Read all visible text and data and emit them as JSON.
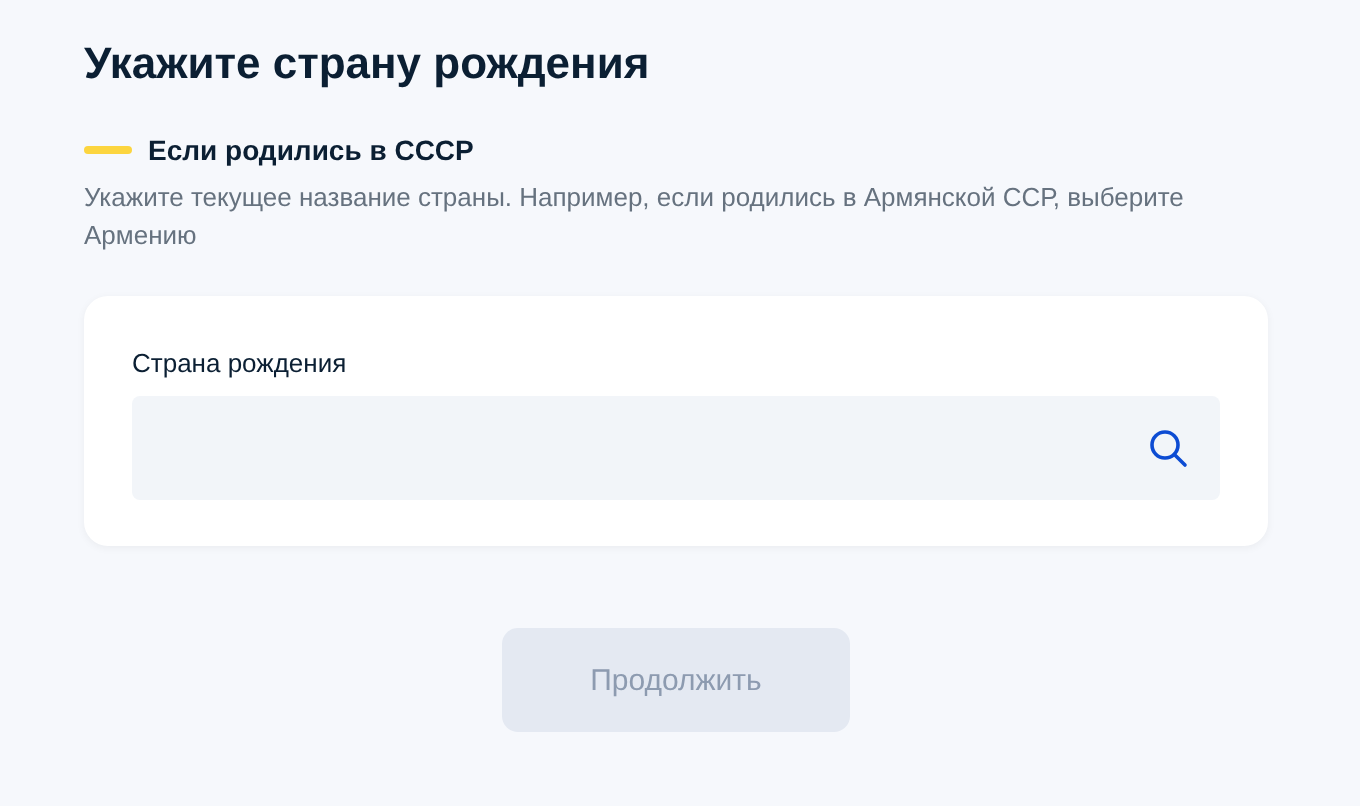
{
  "title": "Укажите страну рождения",
  "hint": {
    "title": "Если родились в СССР",
    "text": "Укажите текущее название страны. Например, если родились в Армянской ССР, выберите Армению"
  },
  "field": {
    "label": "Страна рождения"
  },
  "button": {
    "label": "Продолжить",
    "disabled": true
  }
}
